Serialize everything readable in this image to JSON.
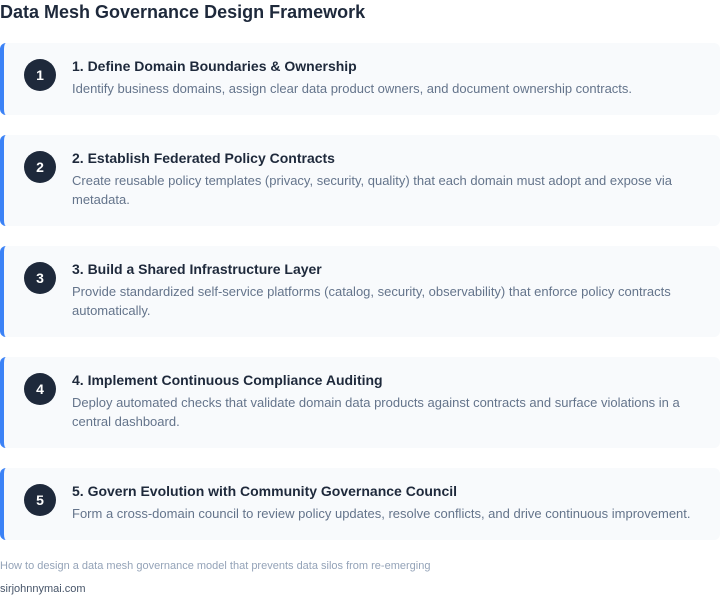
{
  "title": "Data Mesh Governance Design Framework",
  "steps": [
    {
      "number": "1",
      "title": "1. Define Domain Boundaries & Ownership",
      "description": "Identify business domains, assign clear data product owners, and document ownership contracts."
    },
    {
      "number": "2",
      "title": "2. Establish Federated Policy Contracts",
      "description": "Create reusable policy templates (privacy, security, quality) that each domain must adopt and expose via metadata."
    },
    {
      "number": "3",
      "title": "3. Build a Shared Infrastructure Layer",
      "description": "Provide standardized self-service platforms (catalog, security, observability) that enforce policy contracts automatically."
    },
    {
      "number": "4",
      "title": "4. Implement Continuous Compliance Auditing",
      "description": "Deploy automated checks that validate domain data products against contracts and surface violations in a central dashboard."
    },
    {
      "number": "5",
      "title": "5. Govern Evolution with Community Governance Council",
      "description": "Form a cross-domain council to review policy updates, resolve conflicts, and drive continuous improvement."
    }
  ],
  "caption": "How to design a data mesh governance model that prevents data silos from re-emerging",
  "source": "sirjohnnymai.com",
  "colors": {
    "accent": "#3b82f6",
    "badge": "#1e293b",
    "card_background": "#f8fafc",
    "title_text": "#1e293b",
    "description_text": "#64748b"
  }
}
